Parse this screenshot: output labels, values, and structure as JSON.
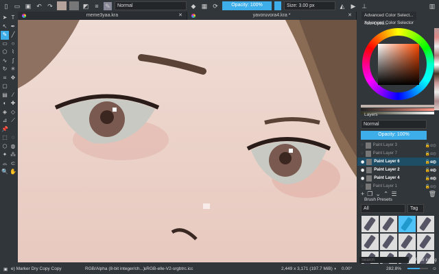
{
  "toolbar": {
    "blend_mode": "Normal",
    "opacity": "Opacity: 100%",
    "size": "Size: 3.00 px",
    "icons": [
      "new-document-icon",
      "open-icon",
      "save-icon",
      "undo-icon",
      "redo-icon"
    ]
  },
  "tabs": [
    {
      "label": "meme3yaa.kra"
    },
    {
      "label": "yavoruvora4.kra *"
    }
  ],
  "dock_tabs": [
    "Advanced Color Select...",
    "Tool Optio..."
  ],
  "color_selector": {
    "title": "Advanced Color Selector",
    "hue_color": "#ff4a00"
  },
  "layers": {
    "title": "Layers",
    "blend_mode": "Normal",
    "opacity": "Opacity:  100%",
    "items": [
      {
        "name": "Paint Layer 3",
        "visible": false
      },
      {
        "name": "Paint Layer 7",
        "visible": false
      },
      {
        "name": "Paint Layer 6",
        "visible": true,
        "selected": true
      },
      {
        "name": "Paint Layer 2",
        "visible": true
      },
      {
        "name": "Paint Layer 4",
        "visible": true
      },
      {
        "name": "Paint Layer 1",
        "visible": false
      }
    ]
  },
  "brush_presets": {
    "title": "Brush Presets",
    "filter": "All",
    "tag_label": "Tag",
    "search_placeholder": "Search",
    "filter_in_tag": "Filter in Tag"
  },
  "status": {
    "brush": "e) Marker Dry Copy Copy",
    "color_space": "RGB/Alpha (8-bit integer/ch...)",
    "profile": "sRGB-elle-V2-srgbtrc.icc",
    "dimensions": "2,449 x 3,171 (197.7 MiB)",
    "rotation": "0.00°",
    "zoom": "282.8%"
  }
}
